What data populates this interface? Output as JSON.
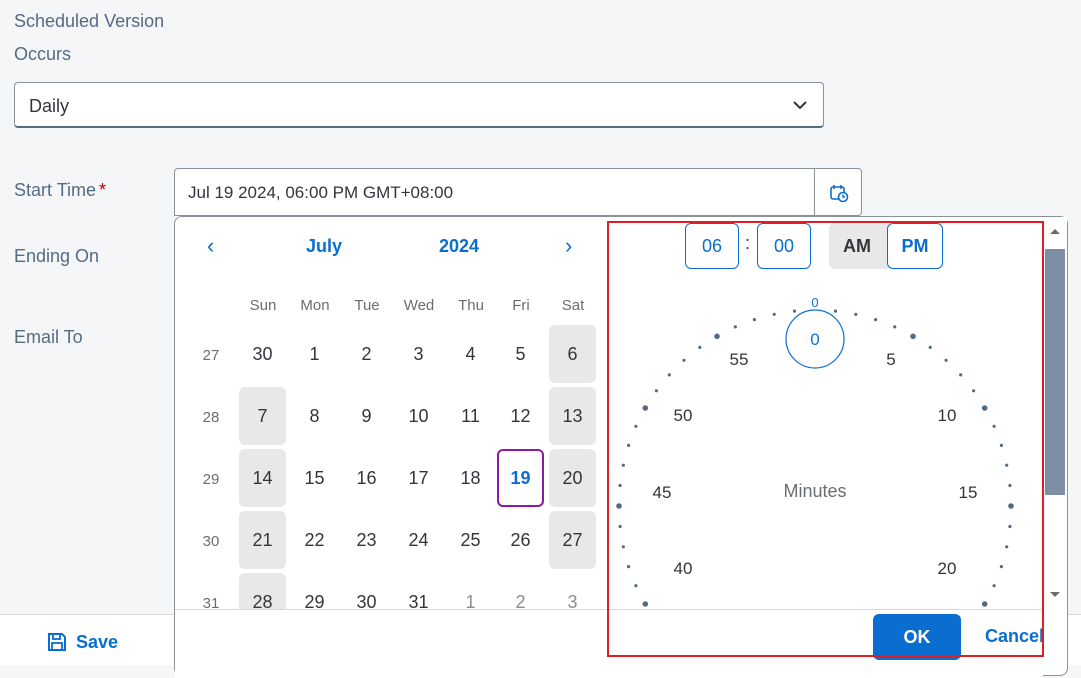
{
  "form": {
    "scheduled_version_label": "Scheduled Version",
    "occurs_label": "Occurs",
    "occurs_value": "Daily",
    "start_time_label": "Start Time",
    "required_mark": "*",
    "start_time_value": "Jul 19 2024, 06:00 PM GMT+08:00",
    "ending_on_label": "Ending On",
    "email_to_label": "Email To"
  },
  "footer": {
    "save_label": "Save"
  },
  "calendar": {
    "month": "July",
    "year": "2024",
    "prev_icon": "‹",
    "next_icon": "›",
    "weekdays": [
      "Sun",
      "Mon",
      "Tue",
      "Wed",
      "Thu",
      "Fri",
      "Sat"
    ],
    "weeks": [
      {
        "num": "27",
        "days": [
          "30",
          "1",
          "2",
          "3",
          "4",
          "5",
          "6"
        ]
      },
      {
        "num": "28",
        "days": [
          "7",
          "8",
          "9",
          "10",
          "11",
          "12",
          "13"
        ]
      },
      {
        "num": "29",
        "days": [
          "14",
          "15",
          "16",
          "17",
          "18",
          "19",
          "20"
        ]
      },
      {
        "num": "30",
        "days": [
          "21",
          "22",
          "23",
          "24",
          "25",
          "26",
          "27"
        ]
      },
      {
        "num": "31",
        "days": [
          "28",
          "29",
          "30",
          "31",
          "1",
          "2",
          "3"
        ]
      }
    ],
    "selected_day": "19"
  },
  "time": {
    "hour": "06",
    "separator": ":",
    "minute": "00",
    "am_label": "AM",
    "pm_label": "PM",
    "clock_center_label": "Minutes",
    "selected_value": "0",
    "top_tick_label": "0",
    "minute_labels": [
      "55",
      "5",
      "50",
      "10",
      "45",
      "15",
      "40",
      "20"
    ]
  },
  "actions": {
    "ok_label": "OK",
    "cancel_label": "Cancel"
  },
  "colors": {
    "accent": "#0a6ed1",
    "selected_day_border": "#8b19a8",
    "highlight": "#dd1e26"
  }
}
